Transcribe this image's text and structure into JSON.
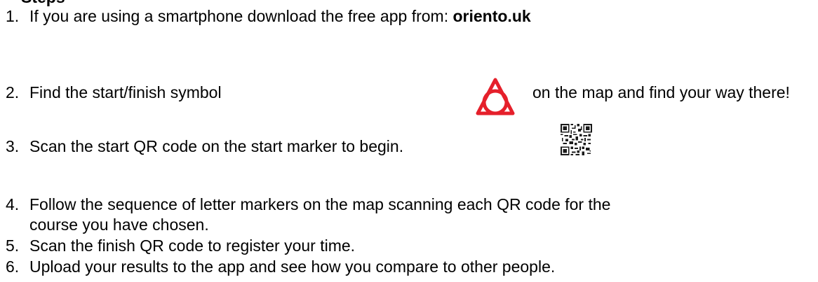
{
  "heading_fragment": "Steps",
  "steps": [
    {
      "num": "1.",
      "text": "If you are using a smartphone download the free app from: ",
      "bold": "oriento.uk"
    },
    {
      "num": "2.",
      "text_before": "Find the start/finish symbol",
      "text_after": "on the map and find your way there!",
      "icon": "start-finish-triangle-circle-icon",
      "icon_color": "#e5202b"
    },
    {
      "num": "3.",
      "text": "Scan the start QR code on the start marker to begin.",
      "icon": "qr-code-icon"
    },
    {
      "num": "4.",
      "line1": "Follow the sequence of letter markers on the map scanning each QR code for the",
      "line2": "course you have chosen."
    },
    {
      "num": "5.",
      "text": "Scan the finish QR code to register your time."
    },
    {
      "num": "6.",
      "text": "Upload your results to the app and see how you compare to other people."
    }
  ]
}
